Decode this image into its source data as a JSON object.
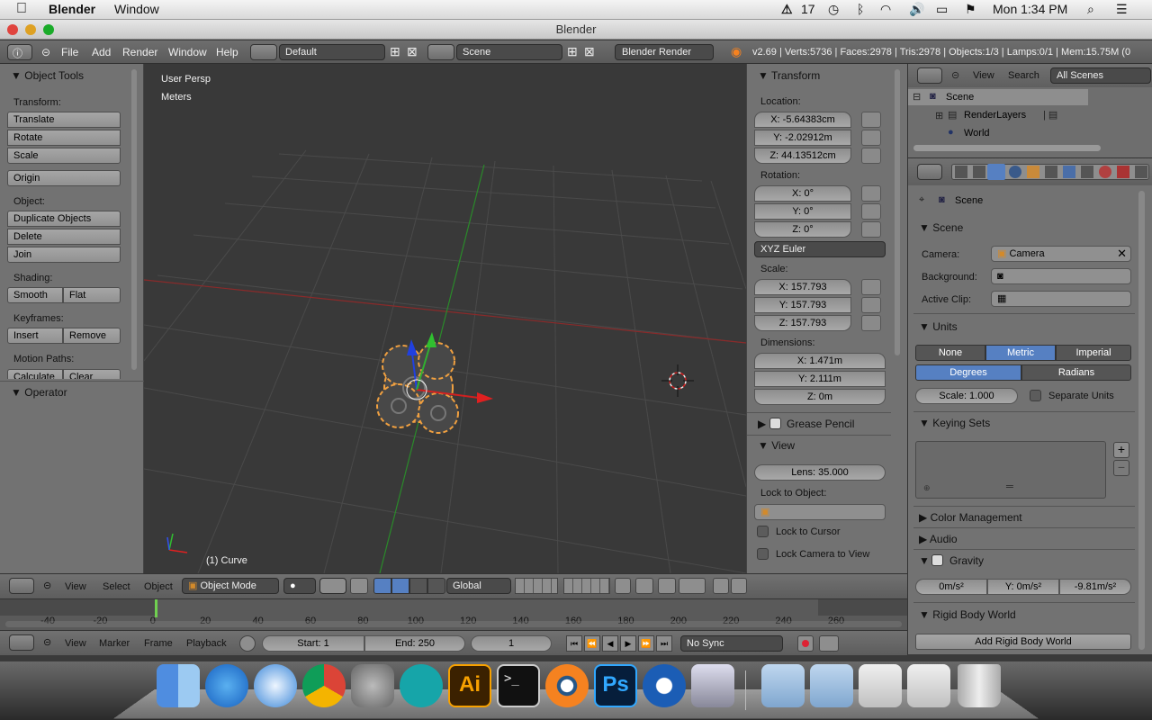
{
  "menubar": {
    "app": "Blender",
    "window": "Window",
    "clock": "Mon 1:34 PM",
    "badge": "17"
  },
  "title": "Blender",
  "header": {
    "menus": [
      "File",
      "Add",
      "Render",
      "Window",
      "Help"
    ],
    "screen": "Default",
    "scene": "Scene",
    "engine": "Blender Render",
    "stats": "v2.69 | Verts:5736 | Faces:2978 | Tris:2978 | Objects:1/3 | Lamps:0/1 | Mem:15.75M (0"
  },
  "tools": {
    "title": "Object Tools",
    "transform_label": "Transform:",
    "translate": "Translate",
    "rotate": "Rotate",
    "scale": "Scale",
    "origin": "Origin",
    "object_label": "Object:",
    "duplicate": "Duplicate Objects",
    "delete": "Delete",
    "join": "Join",
    "shading_label": "Shading:",
    "smooth": "Smooth",
    "flat": "Flat",
    "keyframes_label": "Keyframes:",
    "insert": "Insert",
    "remove": "Remove",
    "motion_label": "Motion Paths:",
    "calculate": "Calculate",
    "clear": "Clear",
    "operator": "Operator"
  },
  "viewport": {
    "persp": "User Persp",
    "units": "Meters",
    "object": "(1) Curve"
  },
  "props": {
    "transform": "Transform",
    "location_label": "Location:",
    "loc": [
      "X: -5.64383cm",
      "Y: -2.02912m",
      "Z: 44.13512cm"
    ],
    "rotation_label": "Rotation:",
    "rot": [
      "X: 0°",
      "Y: 0°",
      "Z: 0°"
    ],
    "rot_mode": "XYZ Euler",
    "scale_label": "Scale:",
    "scl": [
      "X: 157.793",
      "Y: 157.793",
      "Z: 157.793"
    ],
    "dim_label": "Dimensions:",
    "dim": [
      "X: 1.471m",
      "Y: 2.111m",
      "Z: 0m"
    ],
    "grease": "Grease Pencil",
    "view": "View",
    "lens": "Lens: 35.000",
    "lock_obj_label": "Lock to Object:",
    "lock_cursor": "Lock to Cursor",
    "lock_camera": "Lock Camera to View"
  },
  "outliner": {
    "view": "View",
    "search": "Search",
    "filter": "All Scenes",
    "items": [
      "Scene",
      "RenderLayers",
      "World"
    ]
  },
  "scene_props": {
    "crumb": "Scene",
    "scene": "Scene",
    "camera_label": "Camera:",
    "camera": "Camera",
    "background_label": "Background:",
    "clip_label": "Active Clip:",
    "units": "Units",
    "unit_none": "None",
    "unit_metric": "Metric",
    "unit_imperial": "Imperial",
    "degrees": "Degrees",
    "radians": "Radians",
    "scale": "Scale: 1.000",
    "separate": "Separate Units",
    "keying": "Keying Sets",
    "color_mgmt": "Color Management",
    "audio": "Audio",
    "gravity": "Gravity",
    "grav": [
      "0m/s²",
      "Y: 0m/s²",
      "-9.81m/s²"
    ],
    "rigid": "Rigid Body World",
    "add_rigid": "Add Rigid Body World"
  },
  "vheader": {
    "menus": [
      "View",
      "Select",
      "Object"
    ],
    "mode": "Object Mode",
    "orient": "Global"
  },
  "timeline": {
    "ticks": [
      "-40",
      "-20",
      "0",
      "20",
      "40",
      "60",
      "80",
      "100",
      "120",
      "140",
      "160",
      "180",
      "200",
      "220",
      "240",
      "260"
    ],
    "menus": [
      "View",
      "Marker",
      "Frame",
      "Playback"
    ],
    "start": "Start: 1",
    "end": "End: 250",
    "frame": "1",
    "sync": "No Sync"
  },
  "colors": {
    "accent": "#5680c2",
    "selection": "#f0a040",
    "xaxis": "#d02020",
    "yaxis": "#30b030",
    "zaxis": "#2040e0"
  }
}
